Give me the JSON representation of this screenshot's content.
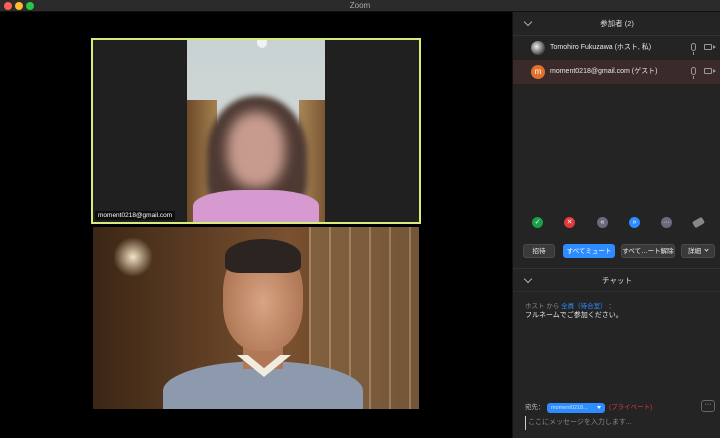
{
  "window": {
    "title": "Zoom"
  },
  "video": {
    "tile1_label": "moment0218@gmail.com"
  },
  "participants": {
    "header": "参加者 (2)",
    "items": [
      {
        "name": "Tomohiro Fukuzawa (ホスト, 私)",
        "avatar_initial": ""
      },
      {
        "name": "moment0218@gmail.com (ゲスト)",
        "avatar_initial": "m"
      }
    ]
  },
  "participant_actions": {
    "invite": "招待",
    "mute_all": "すべてミュート",
    "unmute_all": "すべて…ート解除",
    "more": "詳細"
  },
  "reactions": {
    "yes": "✓",
    "no": "✕",
    "slower": "«",
    "faster": "»",
    "more": "···"
  },
  "chat": {
    "header": "チャット",
    "messages": [
      {
        "from": "ホスト",
        "from_word": "から",
        "to": "全員（待合室）",
        "sep": "：",
        "text": "フルネームでご参加ください。"
      }
    ],
    "to_label": "宛先：",
    "to_value": "moment0218...",
    "private": "(プライベート)",
    "more_button": "···",
    "input_placeholder": "ここにメッセージを入力します..."
  },
  "colors": {
    "accent": "#2d8cff",
    "active_speaker_border": "#d9ec7a",
    "danger": "#e0383b",
    "success": "#19a04a"
  }
}
